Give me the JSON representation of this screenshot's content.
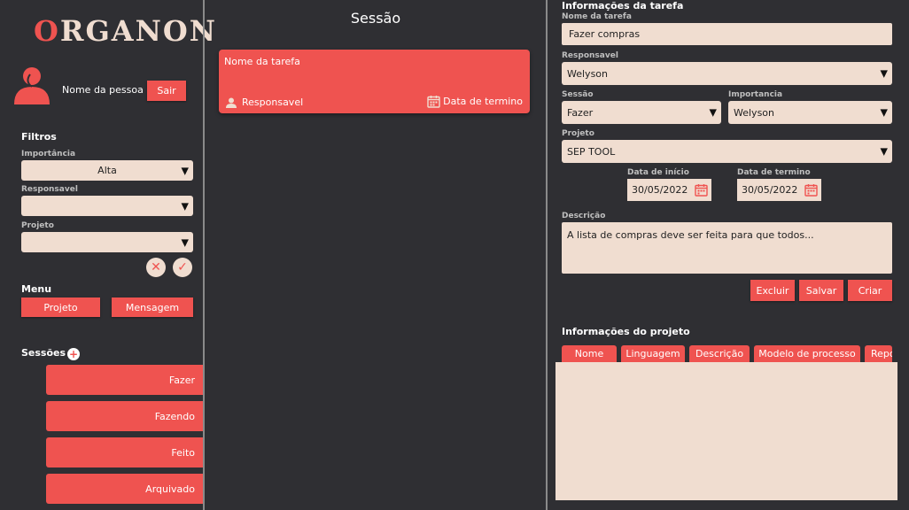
{
  "brand": {
    "logo_text_first": "O",
    "logo_text_rest": "RGANON"
  },
  "user": {
    "name": "Nome da pessoa",
    "logout_label": "Sair"
  },
  "filters": {
    "title": "Filtros",
    "importance_label": "Importância",
    "importance_value": "Alta",
    "responsible_label": "Responsavel",
    "responsible_value": "",
    "project_label": "Projeto",
    "project_value": ""
  },
  "menu": {
    "title": "Menu",
    "project_label": "Projeto",
    "message_label": "Mensagem"
  },
  "sessions": {
    "title": "Sessões",
    "items": [
      {
        "label": "Fazer"
      },
      {
        "label": "Fazendo"
      },
      {
        "label": "Feito"
      },
      {
        "label": "Arquivado"
      }
    ]
  },
  "middle": {
    "title": "Sessão",
    "card": {
      "name": "Nome da tarefa",
      "responsible": "Responsavel",
      "end_date": "Data de termino"
    }
  },
  "task_info": {
    "title": "Informações da tarefa",
    "name_label": "Nome da tarefa",
    "name_value": "Fazer compras",
    "responsible_label": "Responsavel",
    "responsible_value": "Welyson",
    "session_label": "Sessão",
    "session_value": "Fazer",
    "importance_label": "Importancia",
    "importance_value": "Welyson",
    "project_label": "Projeto",
    "project_value": "SEP TOOL",
    "start_label": "Data de início",
    "start_value": "30/05/2022",
    "end_label": "Data de termino",
    "end_value": "30/05/2022",
    "description_label": "Descrição",
    "description_value": "A lista de compras deve ser feita para que todos...",
    "delete_label": "Excluir",
    "save_label": "Salvar",
    "create_label": "Criar"
  },
  "project_info": {
    "title": "Informações do projeto",
    "tabs": [
      {
        "label": "Nome"
      },
      {
        "label": "Linguagem"
      },
      {
        "label": "Descrição"
      },
      {
        "label": "Modelo de processo"
      },
      {
        "label": "Repo"
      }
    ]
  },
  "colors": {
    "accent": "#ef5350",
    "background": "#2f2f33",
    "field": "#f0ddd0"
  },
  "icons": [
    "user-avatar-icon",
    "clear-filter-icon",
    "apply-filter-icon",
    "add-session-icon",
    "person-icon",
    "calendar-icon",
    "dropdown-arrow-icon"
  ]
}
